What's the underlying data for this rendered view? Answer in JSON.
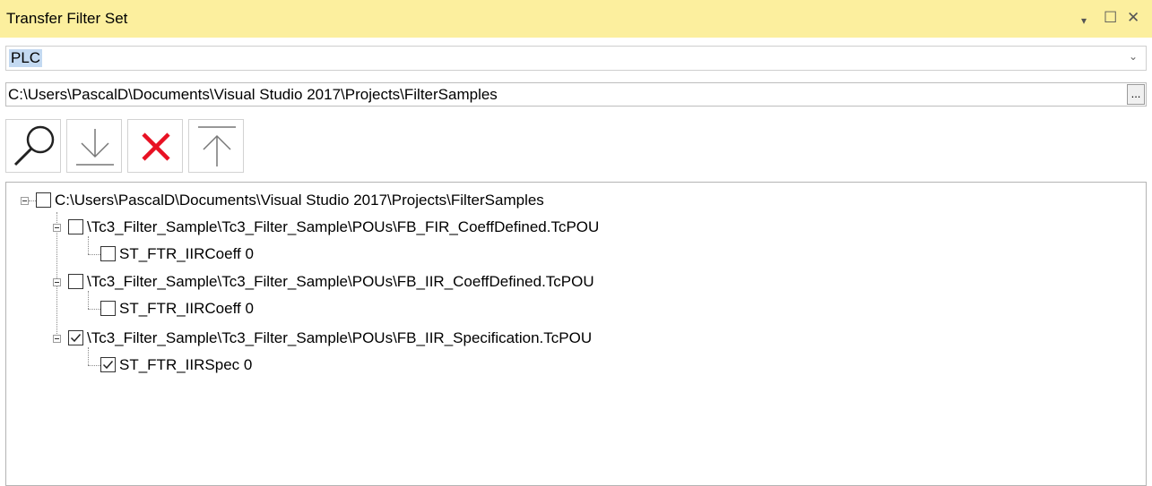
{
  "window": {
    "title": "Transfer Filter Set",
    "controls": [
      "▾",
      "☐",
      "✕"
    ]
  },
  "project_combo": {
    "value": "PLC"
  },
  "path_field": {
    "value": "C:\\Users\\PascalD\\Documents\\Visual Studio 2017\\Projects\\FilterSamples",
    "browse_label": "..."
  },
  "toolbar": {
    "buttons": [
      {
        "icon": "search-icon"
      },
      {
        "icon": "download-arrow-icon"
      },
      {
        "icon": "delete-x-icon",
        "color": "#e81123"
      },
      {
        "icon": "upload-arrow-icon"
      }
    ]
  },
  "tree": {
    "root": {
      "label": "C:\\Users\\PascalD\\Documents\\Visual Studio 2017\\Projects\\FilterSamples",
      "checked": false
    },
    "files": [
      {
        "label": "\\Tc3_Filter_Sample\\Tc3_Filter_Sample\\POUs\\FB_FIR_CoeffDefined.TcPOU",
        "checked": false,
        "child": {
          "label": "ST_FTR_IIRCoeff 0",
          "checked": false
        }
      },
      {
        "label": "\\Tc3_Filter_Sample\\Tc3_Filter_Sample\\POUs\\FB_IIR_CoeffDefined.TcPOU",
        "checked": false,
        "child": {
          "label": "ST_FTR_IIRCoeff 0",
          "checked": false
        }
      },
      {
        "label": "\\Tc3_Filter_Sample\\Tc3_Filter_Sample\\POUs\\FB_IIR_Specification.TcPOU",
        "checked": true,
        "child": {
          "label": "ST_FTR_IIRSpec 0",
          "checked": true
        }
      }
    ]
  }
}
